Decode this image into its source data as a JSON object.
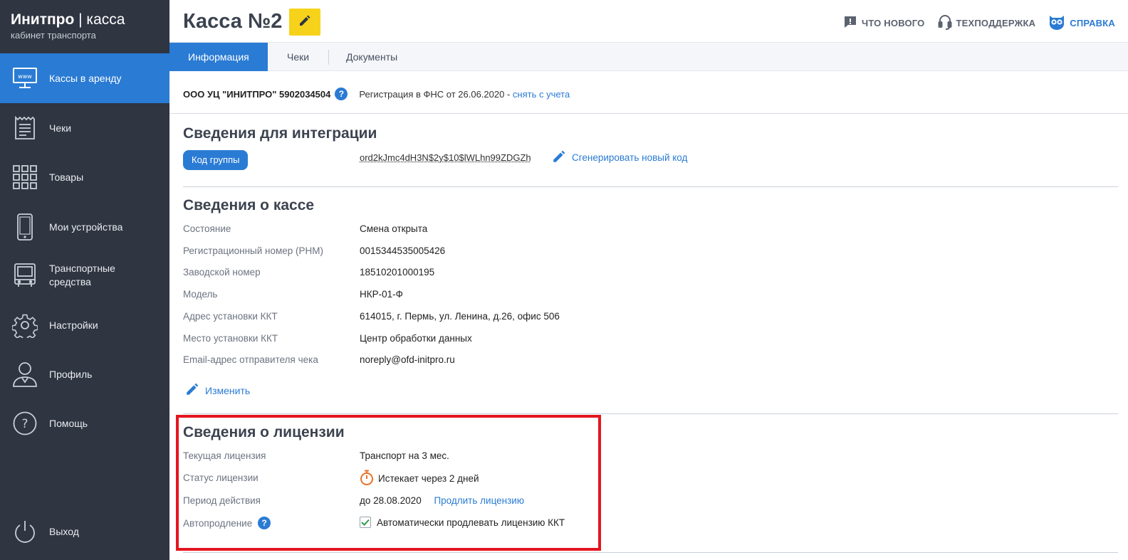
{
  "brand": {
    "name_bold": "Инитпро",
    "name_rest": " | касса",
    "subtitle": "кабинет транспорта"
  },
  "nav": [
    {
      "label": "Кассы в аренду",
      "icon": "monitor-icon",
      "active": true
    },
    {
      "label": "Чеки",
      "icon": "receipt-icon"
    },
    {
      "label": "Товары",
      "icon": "grid-icon"
    },
    {
      "label": "Мои устройства",
      "icon": "phone-icon"
    },
    {
      "label": "Транспортные средства",
      "icon": "bus-icon"
    },
    {
      "label": "Настройки",
      "icon": "gear-icon"
    },
    {
      "label": "Профиль",
      "icon": "user-icon"
    },
    {
      "label": "Помощь",
      "icon": "question-icon"
    },
    {
      "label": "Выход",
      "icon": "power-icon"
    }
  ],
  "header": {
    "title": "Касса №2",
    "links": {
      "whats_new": "ЧТО НОВОГО",
      "support": "ТЕХПОДДЕРЖКА",
      "help": "СПРАВКА"
    }
  },
  "tabs": [
    "Информация",
    "Чеки",
    "Документы"
  ],
  "org": {
    "name": "ООО УЦ \"ИНИТПРО\" 5902034504",
    "registration": "Регистрация в ФНС от 26.06.2020",
    "separator": " - ",
    "unregister": "снять с учета"
  },
  "integration": {
    "title": "Сведения для интеграции",
    "group_label": "Код группы",
    "code": "ord2kJmc4dH3N$2y$10$lWLhn99ZDGZh",
    "generate": "Сгенерировать новый код"
  },
  "kassa": {
    "title": "Сведения о кассе",
    "rows": [
      {
        "label": "Состояние",
        "value": "Смена открыта"
      },
      {
        "label": "Регистрационный номер (РНМ)",
        "value": "0015344535005426"
      },
      {
        "label": "Заводской номер",
        "value": "18510201000195"
      },
      {
        "label": "Модель",
        "value": "НКР-01-Ф"
      },
      {
        "label": "Адрес установки ККТ",
        "value": "614015, г. Пермь, ул. Ленина, д.26, офис 506"
      },
      {
        "label": "Место установки ККТ",
        "value": "Центр обработки данных"
      },
      {
        "label": "Email-адрес отправителя чека",
        "value": "noreply@ofd-initpro.ru"
      }
    ],
    "change": "Изменить"
  },
  "license": {
    "title": "Сведения о лицензии",
    "current_label": "Текущая лицензия",
    "current_value": "Транспорт на 3 мес.",
    "status_label": "Статус лицензии",
    "status_value": "Истекает через 2 дней",
    "period_label": "Период действия",
    "period_value": "до 28.08.2020",
    "prolong": "Продлить лицензию",
    "auto_label": "Автопродление",
    "auto_value": "Автоматически продлевать лицензию ККТ",
    "auto_checked": true
  },
  "colors": {
    "accent": "#2a7bd4",
    "sidebar": "#2f3541",
    "highlight": "#e4151f",
    "edit": "#f7d21a",
    "timer": "#e8732a",
    "check": "#2e9a4a"
  }
}
